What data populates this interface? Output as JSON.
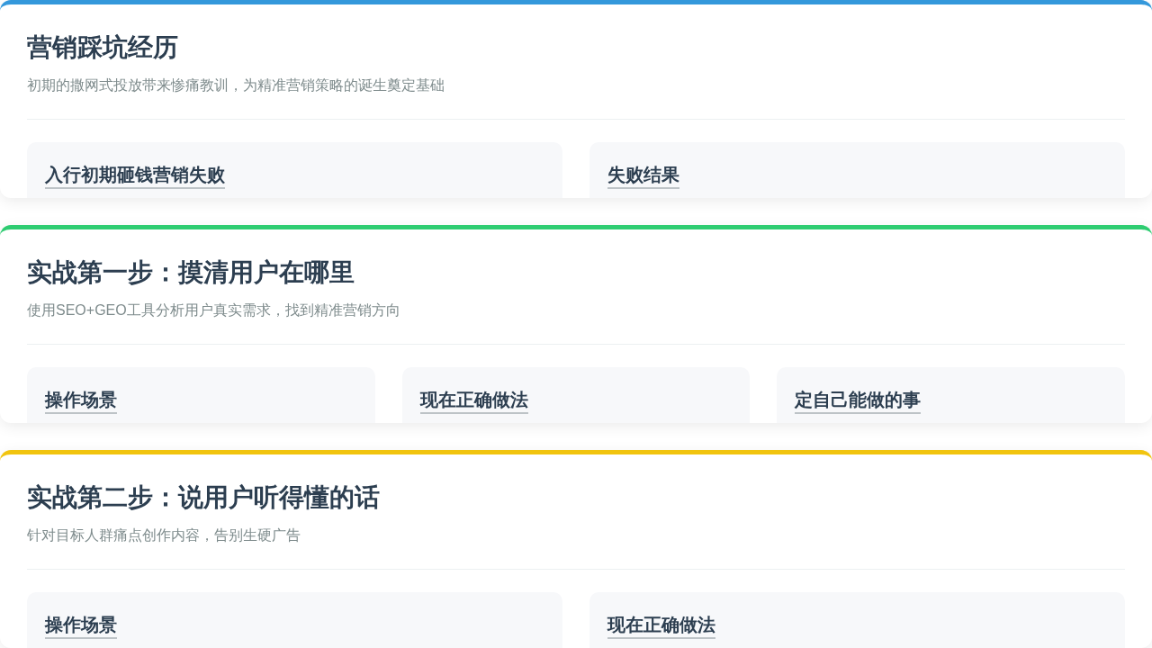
{
  "sections": [
    {
      "title": "营销踩坑经历",
      "subtitle": "初期的撒网式投放带来惨痛教训，为精准营销策略的诞生奠定基础",
      "color": "#3498db",
      "panels": [
        {
          "heading": "入行初期砸钱营销失败"
        },
        {
          "heading": "失败结果"
        }
      ]
    },
    {
      "title": "实战第一步：摸清用户在哪里",
      "subtitle": "使用SEO+GEO工具分析用户真实需求，找到精准营销方向",
      "color": "#2ecc71",
      "panels": [
        {
          "heading": "操作场景"
        },
        {
          "heading": "现在正确做法"
        },
        {
          "heading": "定自己能做的事"
        }
      ]
    },
    {
      "title": "实战第二步：说用户听得懂的话",
      "subtitle": "针对目标人群痛点创作内容，告别生硬广告",
      "color": "#f1c40f",
      "panels": [
        {
          "heading": "操作场景"
        },
        {
          "heading": "现在正确做法"
        }
      ]
    }
  ]
}
